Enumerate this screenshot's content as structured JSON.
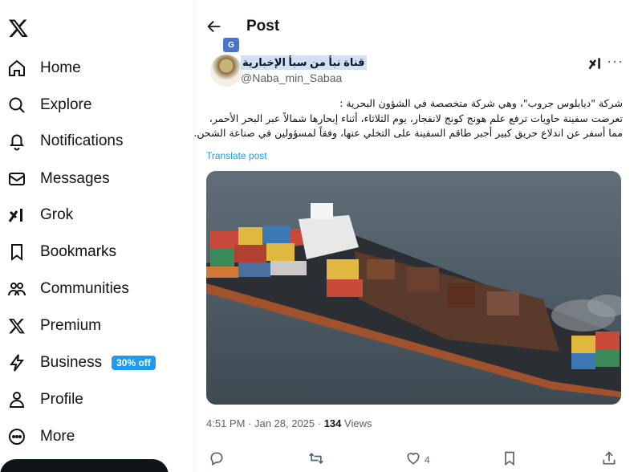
{
  "nav": {
    "logo_icon": "x-logo-icon",
    "items": [
      {
        "label": "Home",
        "icon": "home-icon"
      },
      {
        "label": "Explore",
        "icon": "search-icon"
      },
      {
        "label": "Notifications",
        "icon": "bell-icon"
      },
      {
        "label": "Messages",
        "icon": "envelope-icon"
      },
      {
        "label": "Grok",
        "icon": "grok-icon"
      },
      {
        "label": "Bookmarks",
        "icon": "bookmark-icon"
      },
      {
        "label": "Communities",
        "icon": "people-icon"
      },
      {
        "label": "Premium",
        "icon": "x-logo-icon"
      },
      {
        "label": "Business",
        "icon": "lightning-icon",
        "badge": "30% off"
      },
      {
        "label": "Profile",
        "icon": "person-icon"
      },
      {
        "label": "More",
        "icon": "more-circle-icon"
      }
    ]
  },
  "header": {
    "title": "Post",
    "back_icon": "arrow-left-icon",
    "translate_chip": "G"
  },
  "post": {
    "author_name": "قناة نبأ من سبأ الإخبارية",
    "author_handle": "@Naba_min_Sabaa",
    "text_lines": [
      "شركة \"ديابلوس جروب\"، وهي شركة متخصصة في الشؤون البحرية :",
      "تعرضت سفينة حاويات ترفع علم هونج كونج لانفجار، يوم الثلاثاء، أثناء إبحارها شمالاً عبر البحر الأحمر،",
      "مما أسفر عن اندلاع حريق كبير أجبر طاقم السفينة على التخلي عنها، وفقاً لمسؤولين في صناعة الشحن."
    ],
    "translate_label": "Translate post",
    "photo_icon": "ship-photo",
    "time": "4:51 PM · Jan 28, 2025 · ",
    "views_count": "134",
    "views_label": " Views",
    "likes_count": "4"
  },
  "colors": {
    "accent": "#1d9bf0",
    "text": "#0f1419",
    "muted": "#536471",
    "highlight": "#cfe0f7"
  }
}
